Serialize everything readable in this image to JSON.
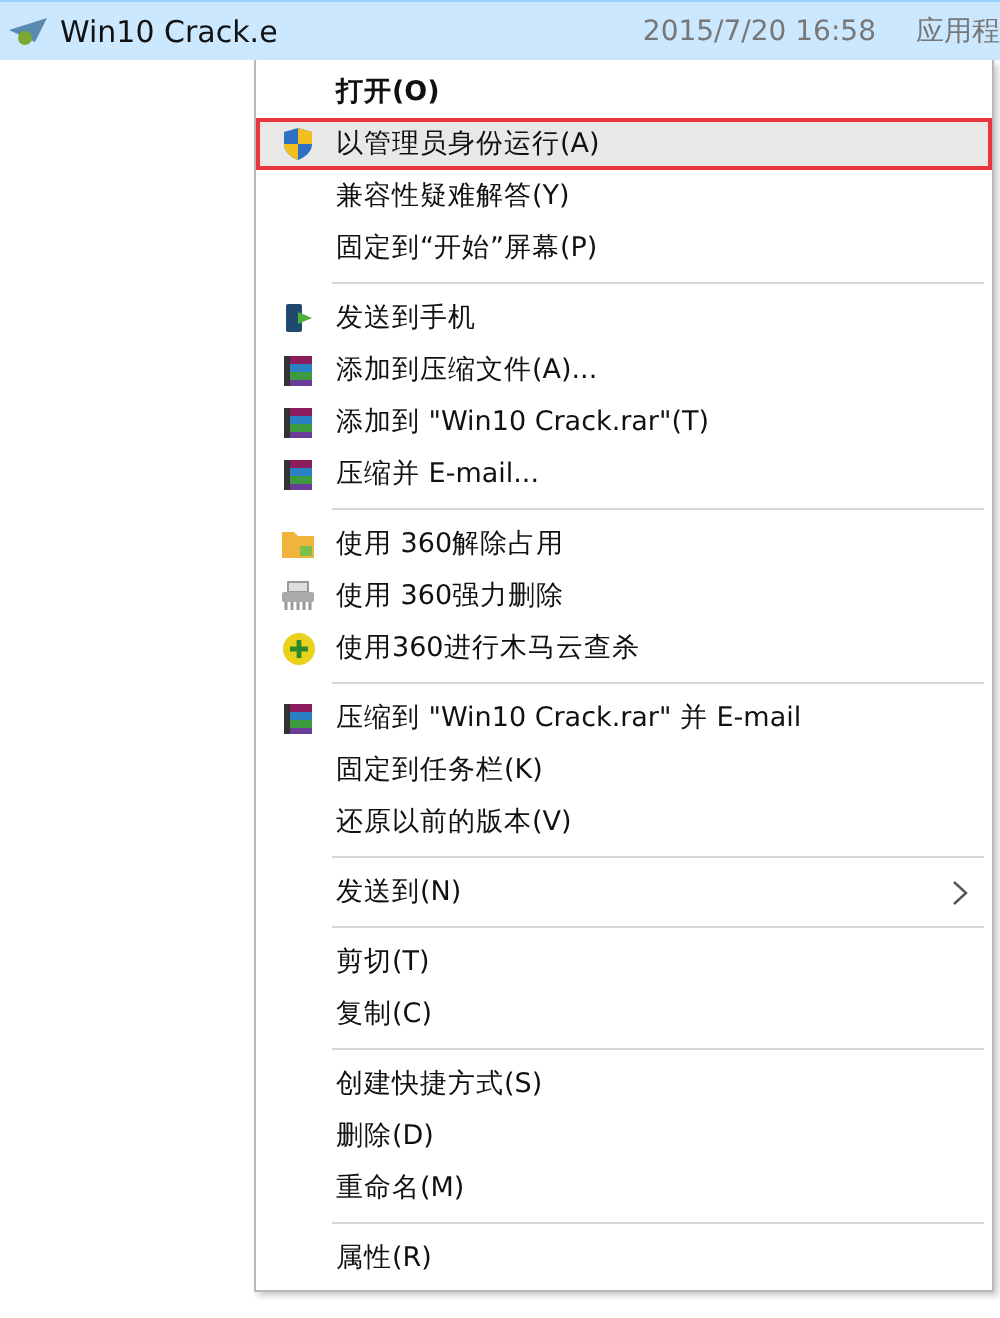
{
  "file_row": {
    "name": "Win10 Crack.e",
    "date": "2015/7/20 16:58",
    "type": "应用程",
    "selected": true
  },
  "menu": {
    "items": [
      {
        "label": "打开(O)",
        "kind": "plain",
        "bold": true,
        "selected": false
      },
      {
        "label": "以管理员身份运行(A)",
        "kind": "shield",
        "bold": false,
        "selected": true
      },
      {
        "label": "兼容性疑难解答(Y)",
        "kind": "plain",
        "bold": false,
        "selected": false
      },
      {
        "label": "固定到“开始”屏幕(P)",
        "kind": "plain",
        "bold": false,
        "selected": false,
        "separator_after": true
      },
      {
        "label": "发送到手机",
        "kind": "phone",
        "bold": false,
        "selected": false
      },
      {
        "label": "添加到压缩文件(A)...",
        "kind": "archive",
        "bold": false,
        "selected": false
      },
      {
        "label": "添加到 \"Win10 Crack.rar\"(T)",
        "kind": "archive",
        "bold": false,
        "selected": false
      },
      {
        "label": "压缩并 E-mail...",
        "kind": "archive",
        "bold": false,
        "selected": false,
        "separator_after": true
      },
      {
        "label": "使用 360解除占用",
        "kind": "unlock",
        "bold": false,
        "selected": false
      },
      {
        "label": "使用 360强力删除",
        "kind": "shredder",
        "bold": false,
        "selected": false
      },
      {
        "label": "使用360进行木马云查杀",
        "kind": "scan",
        "bold": false,
        "selected": false,
        "separator_after": true
      },
      {
        "label": "压缩到 \"Win10 Crack.rar\" 并 E-mail",
        "kind": "archive",
        "bold": false,
        "selected": false
      },
      {
        "label": "固定到任务栏(K)",
        "kind": "plain",
        "bold": false,
        "selected": false
      },
      {
        "label": "还原以前的版本(V)",
        "kind": "plain",
        "bold": false,
        "selected": false,
        "separator_after": true
      },
      {
        "label": "发送到(N)",
        "kind": "submenu",
        "bold": false,
        "selected": false,
        "separator_after": true
      },
      {
        "label": "剪切(T)",
        "kind": "plain",
        "bold": false,
        "selected": false
      },
      {
        "label": "复制(C)",
        "kind": "plain",
        "bold": false,
        "selected": false,
        "separator_after": true
      },
      {
        "label": "创建快捷方式(S)",
        "kind": "plain",
        "bold": false,
        "selected": false
      },
      {
        "label": "删除(D)",
        "kind": "plain",
        "bold": false,
        "selected": false
      },
      {
        "label": "重命名(M)",
        "kind": "plain",
        "bold": false,
        "selected": false,
        "separator_after": true
      },
      {
        "label": "属性(R)",
        "kind": "plain",
        "bold": false,
        "selected": false
      }
    ]
  }
}
